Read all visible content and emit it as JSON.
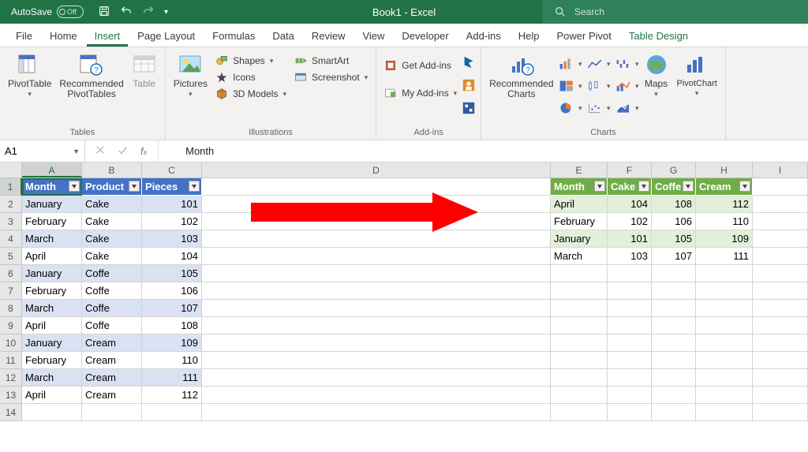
{
  "titlebar": {
    "autosave_label": "AutoSave",
    "autosave_state": "Off",
    "title": "Book1  -  Excel",
    "search_placeholder": "Search"
  },
  "tabs": [
    "File",
    "Home",
    "Insert",
    "Page Layout",
    "Formulas",
    "Data",
    "Review",
    "View",
    "Developer",
    "Add-ins",
    "Help",
    "Power Pivot",
    "Table Design"
  ],
  "active_tab": "Insert",
  "contextual_tab": "Table Design",
  "ribbon": {
    "tables": {
      "label": "Tables",
      "pivottable": "PivotTable",
      "recommended_pt": "Recommended\nPivotTables",
      "table": "Table"
    },
    "illustrations": {
      "label": "Illustrations",
      "pictures": "Pictures",
      "shapes": "Shapes",
      "icons": "Icons",
      "models": "3D Models",
      "smartart": "SmartArt",
      "screenshot": "Screenshot"
    },
    "addins": {
      "label": "Add-ins",
      "get": "Get Add-ins",
      "my": "My Add-ins"
    },
    "charts": {
      "label": "Charts",
      "recommended": "Recommended\nCharts",
      "maps": "Maps",
      "pivotchart": "PivotChart"
    }
  },
  "formula_bar": {
    "namebox": "A1",
    "formula": "Month"
  },
  "columns": [
    "A",
    "B",
    "C",
    "D",
    "E",
    "F",
    "G",
    "H",
    "I"
  ],
  "selected_col": "A",
  "selected_row": 1,
  "blue_table": {
    "headers": [
      "Month",
      "Product",
      "Pieces"
    ],
    "rows": [
      [
        "January",
        "Cake",
        101
      ],
      [
        "February",
        "Cake",
        102
      ],
      [
        "March",
        "Cake",
        103
      ],
      [
        "April",
        "Cake",
        104
      ],
      [
        "January",
        "Coffe",
        105
      ],
      [
        "February",
        "Coffe",
        106
      ],
      [
        "March",
        "Coffe",
        107
      ],
      [
        "April",
        "Coffe",
        108
      ],
      [
        "January",
        "Cream",
        109
      ],
      [
        "February",
        "Cream",
        110
      ],
      [
        "March",
        "Cream",
        111
      ],
      [
        "April",
        "Cream",
        112
      ]
    ]
  },
  "green_table": {
    "headers": [
      "Month",
      "Cake",
      "Coffe",
      "Cream"
    ],
    "rows": [
      [
        "April",
        104,
        108,
        112
      ],
      [
        "February",
        102,
        106,
        110
      ],
      [
        "January",
        101,
        105,
        109
      ],
      [
        "March",
        103,
        107,
        111
      ]
    ]
  },
  "chart_data": {
    "type": "table",
    "note": "Screenshot shows two Excel tables; no graphical chart is plotted.",
    "source": {
      "columns": [
        "Month",
        "Product",
        "Pieces"
      ],
      "rows": [
        [
          "January",
          "Cake",
          101
        ],
        [
          "February",
          "Cake",
          102
        ],
        [
          "March",
          "Cake",
          103
        ],
        [
          "April",
          "Cake",
          104
        ],
        [
          "January",
          "Coffe",
          105
        ],
        [
          "February",
          "Coffe",
          106
        ],
        [
          "March",
          "Coffe",
          107
        ],
        [
          "April",
          "Coffe",
          108
        ],
        [
          "January",
          "Cream",
          109
        ],
        [
          "February",
          "Cream",
          110
        ],
        [
          "March",
          "Cream",
          111
        ],
        [
          "April",
          "Cream",
          112
        ]
      ]
    },
    "pivot": {
      "row_field": "Month",
      "column_field": "Product",
      "value_field": "Pieces",
      "categories": [
        "April",
        "February",
        "January",
        "March"
      ],
      "series": [
        {
          "name": "Cake",
          "values": [
            104,
            102,
            101,
            103
          ]
        },
        {
          "name": "Coffe",
          "values": [
            108,
            106,
            105,
            107
          ]
        },
        {
          "name": "Cream",
          "values": [
            112,
            110,
            109,
            111
          ]
        }
      ]
    }
  }
}
